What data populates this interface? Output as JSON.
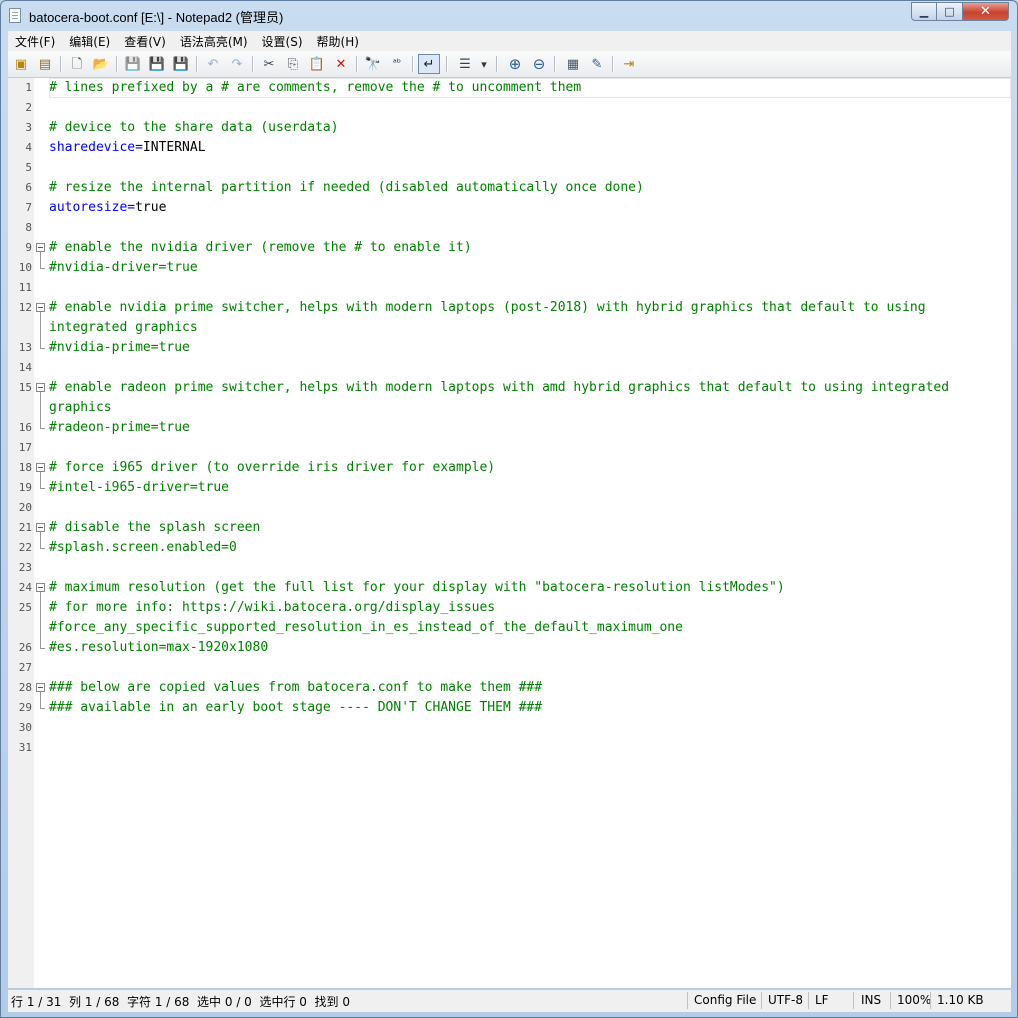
{
  "window": {
    "title": "batocera-boot.conf [E:\\] - Notepad2 (管理员)",
    "caption_buttons": {
      "minimize": "▁",
      "maximize": "□",
      "close": "✕"
    }
  },
  "menu": [
    "文件(F)",
    "编辑(E)",
    "查看(V)",
    "语法高亮(M)",
    "设置(S)",
    "帮助(H)"
  ],
  "toolbar": [
    {
      "name": "run-icon",
      "glyph": "▣"
    },
    {
      "name": "find-file-icon",
      "glyph": "▤"
    },
    {
      "name": "new-file-icon",
      "glyph": "🗋"
    },
    {
      "name": "open-folder-icon",
      "glyph": "📂"
    },
    {
      "name": "save-icon",
      "glyph": "💾"
    },
    {
      "name": "save-as-icon",
      "glyph": "💾"
    },
    {
      "name": "save-copy-icon",
      "glyph": "💾"
    },
    {
      "name": "undo-icon",
      "glyph": "↶"
    },
    {
      "name": "redo-icon",
      "glyph": "↷"
    },
    {
      "name": "cut-icon",
      "glyph": "✂"
    },
    {
      "name": "copy-icon",
      "glyph": "⎘"
    },
    {
      "name": "paste-icon",
      "glyph": "📋"
    },
    {
      "name": "delete-icon",
      "glyph": "✕"
    },
    {
      "name": "find-icon",
      "glyph": "🔭"
    },
    {
      "name": "replace-icon",
      "glyph": "ᵃᵇ"
    },
    {
      "name": "word-wrap-icon",
      "glyph": "↵"
    },
    {
      "name": "list-icon",
      "glyph": "☰"
    },
    {
      "name": "dropdown-arrow-icon",
      "glyph": "▾"
    },
    {
      "name": "zoom-in-icon",
      "glyph": "⊕"
    },
    {
      "name": "zoom-out-icon",
      "glyph": "⊖"
    },
    {
      "name": "scheme-icon",
      "glyph": "▦"
    },
    {
      "name": "customize-icon",
      "glyph": "✎"
    },
    {
      "name": "exit-icon",
      "glyph": "⇥"
    }
  ],
  "editor": {
    "line_numbers": [
      "1",
      "2",
      "3",
      "4",
      "5",
      "6",
      "7",
      "8",
      "9",
      "10",
      "11",
      "12",
      "13",
      "14",
      "15",
      "16",
      "17",
      "18",
      "19",
      "20",
      "21",
      "22",
      "23",
      "24",
      "25",
      "26",
      "27",
      "28",
      "29",
      "30",
      "31"
    ],
    "lines": [
      {
        "text": "# lines prefixed by a # are comments, remove the # to uncomment them",
        "kind": "comment"
      },
      {
        "text": "",
        "kind": "blank"
      },
      {
        "text": "# device to the share data (userdata)",
        "kind": "comment"
      },
      {
        "key": "sharedevice",
        "eq": "=",
        "value": "INTERNAL",
        "kind": "kv"
      },
      {
        "text": "",
        "kind": "blank"
      },
      {
        "text": "# resize the internal partition if needed (disabled automatically once done)",
        "kind": "comment"
      },
      {
        "key": "autoresize",
        "eq": "=",
        "value": "true",
        "kind": "kv"
      },
      {
        "text": "",
        "kind": "blank"
      },
      {
        "text": "# enable the nvidia driver (remove the # to enable it)",
        "kind": "comment"
      },
      {
        "text": "#nvidia-driver=true",
        "kind": "comment"
      },
      {
        "text": "",
        "kind": "blank"
      },
      {
        "text": "# enable nvidia prime switcher, helps with modern laptops (post-2018) with hybrid graphics that default to using",
        "kind": "comment"
      },
      {
        "text": "integrated graphics",
        "kind": "comment"
      },
      {
        "text": "#nvidia-prime=true",
        "kind": "comment"
      },
      {
        "text": "",
        "kind": "blank"
      },
      {
        "text": "# enable radeon prime switcher, helps with modern laptops with amd hybrid graphics that default to using integrated",
        "kind": "comment"
      },
      {
        "text": "graphics",
        "kind": "comment"
      },
      {
        "text": "#radeon-prime=true",
        "kind": "comment"
      },
      {
        "text": "",
        "kind": "blank"
      },
      {
        "text": "# force i965 driver (to override iris driver for example)",
        "kind": "comment"
      },
      {
        "text": "#intel-i965-driver=true",
        "kind": "comment"
      },
      {
        "text": "",
        "kind": "blank"
      },
      {
        "text": "# disable the splash screen",
        "kind": "comment"
      },
      {
        "text": "#splash.screen.enabled=0",
        "kind": "comment"
      },
      {
        "text": "",
        "kind": "blank"
      },
      {
        "text": "# maximum resolution (get the full list for your display with \"batocera-resolution listModes\")",
        "kind": "comment"
      },
      {
        "text": "# for more info: https://wiki.batocera.org/display_issues",
        "kind": "comment"
      },
      {
        "text": "#force_any_specific_supported_resolution_in_es_instead_of_the_default_maximum_one",
        "kind": "comment"
      },
      {
        "text": "#es.resolution=max-1920x1080",
        "kind": "comment"
      },
      {
        "text": "",
        "kind": "blank"
      },
      {
        "text": "### below are copied values from batocera.conf to make them ###",
        "kind": "comment"
      },
      {
        "text": "### available in an early boot stage ---- DON'T CHANGE THEM ###",
        "kind": "comment"
      },
      {
        "text": "",
        "kind": "blank"
      },
      {
        "text": "",
        "kind": "blank"
      }
    ]
  },
  "status": {
    "position": "行 1 / 31  列 1 / 68  字符 1 / 68  选中 0 / 0  选中行 0  找到 0",
    "scheme": "Config File",
    "encoding": "UTF-8",
    "eol": "LF",
    "ovr": "INS",
    "zoom": "100%",
    "size": "1.10 KB"
  }
}
